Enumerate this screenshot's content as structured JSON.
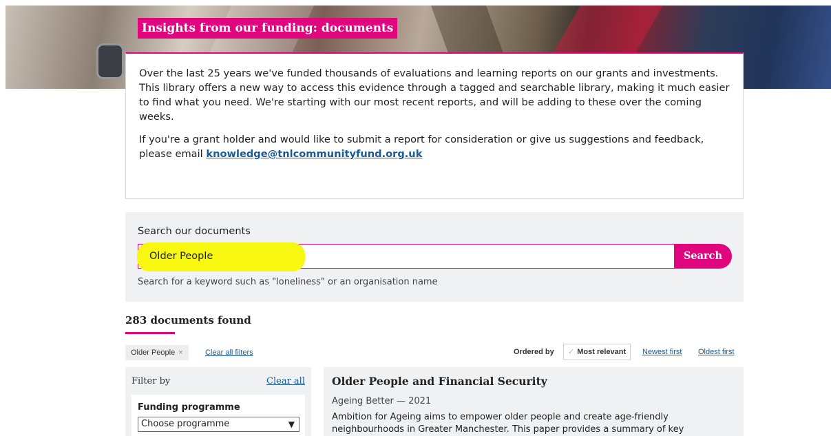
{
  "page_title": "Insights from our funding: documents",
  "intro": {
    "paragraph1": "Over the last 25 years we've funded thousands of evaluations and learning reports on our grants and investments. This library offers a new way to access this evidence through a tagged and searchable library, making it much easier to find what you need. We're starting with our most recent reports, and will be adding to these over the coming weeks.",
    "paragraph2_prefix": "If you're a grant holder and would like to submit a report for consideration or give us suggestions and feedback, please email ",
    "email": "knowledge@tnlcommunityfund.org.uk"
  },
  "search": {
    "label": "Search our documents",
    "value": "Older People",
    "button_label": "Search",
    "hint": "Search for a keyword such as \"loneliness\" or an organisation name"
  },
  "results": {
    "count_text": "283 documents found",
    "active_filter": "Older People",
    "clear_filters_label": "Clear all filters"
  },
  "ordering": {
    "label": "Ordered by",
    "active": "Most relevant",
    "options": [
      "Newest first",
      "Oldest first"
    ]
  },
  "filters": {
    "heading": "Filter by",
    "clear_label": "Clear all",
    "funding_programme": {
      "title": "Funding programme",
      "selected": "Choose programme"
    }
  },
  "result_items": [
    {
      "title": "Older People and Financial Security",
      "meta": "Ageing Better — 2021",
      "description": "Ambition for Ageing aims to empower older people and create age-friendly neighbourhoods in Greater Manchester. This paper provides a summary of key"
    }
  ],
  "colors": {
    "brand_pink": "#e0067d",
    "link_blue": "#1a5a96",
    "highlight": "#f7f712",
    "panel_grey": "#f0f1f3"
  }
}
